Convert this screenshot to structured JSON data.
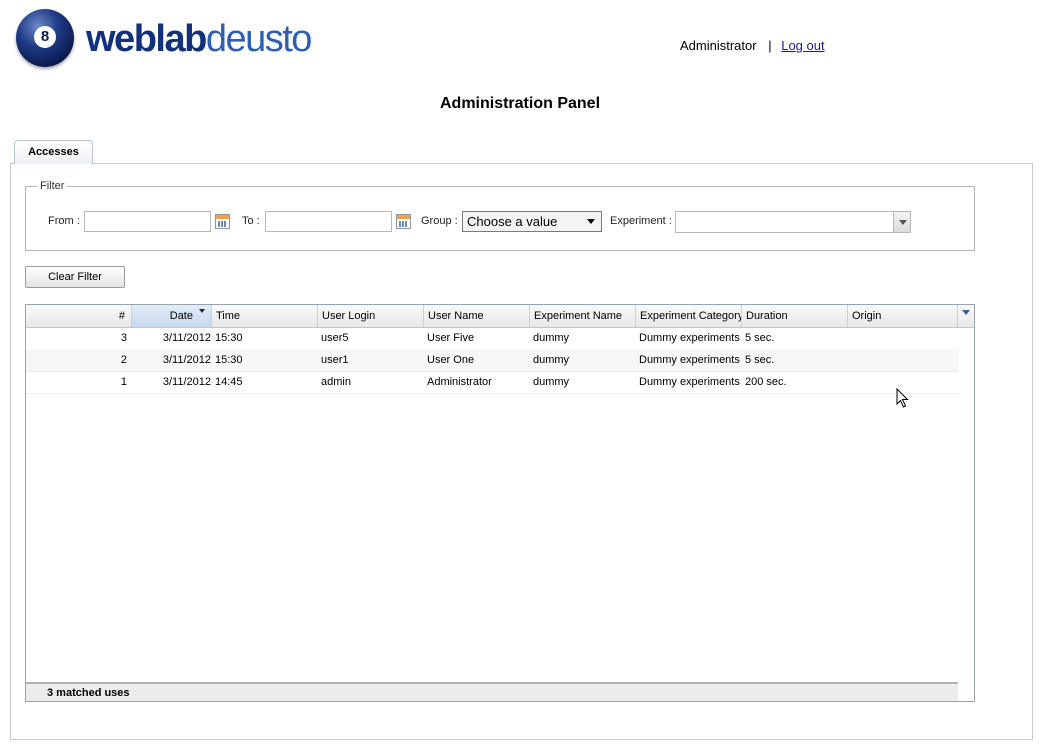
{
  "header": {
    "logo_text_1": "weblab",
    "logo_text_2": "deusto",
    "logo_ball_number": "8",
    "user": "Administrator",
    "separator": "|",
    "logout_label": "Log out"
  },
  "page_title": "Administration Panel",
  "tabs": [
    {
      "label": "Accesses",
      "active": true
    }
  ],
  "filter": {
    "legend": "Filter",
    "from_label": "From :",
    "from_value": "",
    "to_label": "To :",
    "to_value": "",
    "group_label": "Group :",
    "group_value": "Choose a value",
    "experiment_label": "Experiment :",
    "experiment_value": ""
  },
  "clear_filter_label": "Clear Filter",
  "grid": {
    "columns": [
      "#",
      "Date",
      "Time",
      "User Login",
      "User Name",
      "Experiment Name",
      "Experiment Category",
      "Duration",
      "Origin"
    ],
    "sorted_column": "Date",
    "rows": [
      {
        "num": "3",
        "date": "3/11/2012",
        "time": "15:30",
        "login": "user5",
        "name": "User Five",
        "experiment": "dummy",
        "category": "Dummy experiments",
        "duration": "5 sec.",
        "origin": ""
      },
      {
        "num": "2",
        "date": "3/11/2012",
        "time": "15:30",
        "login": "user1",
        "name": "User One",
        "experiment": "dummy",
        "category": "Dummy experiments",
        "duration": "5 sec.",
        "origin": ""
      },
      {
        "num": "1",
        "date": "3/11/2012",
        "time": "14:45",
        "login": "admin",
        "name": "Administrator",
        "experiment": "dummy",
        "category": "Dummy experiments",
        "duration": "200 sec.",
        "origin": ""
      }
    ],
    "footer": "3 matched uses"
  },
  "icons": {
    "calendar": "calendar-icon",
    "dropdown": "chevron-down-icon",
    "sort": "sort-desc-icon",
    "cursor": "mouse-pointer-icon"
  },
  "colors": {
    "logo_dark": "#13317b",
    "logo_light": "#2c5fb3",
    "link": "#1a1aa6",
    "sorted_header": "#c7d8ef"
  }
}
